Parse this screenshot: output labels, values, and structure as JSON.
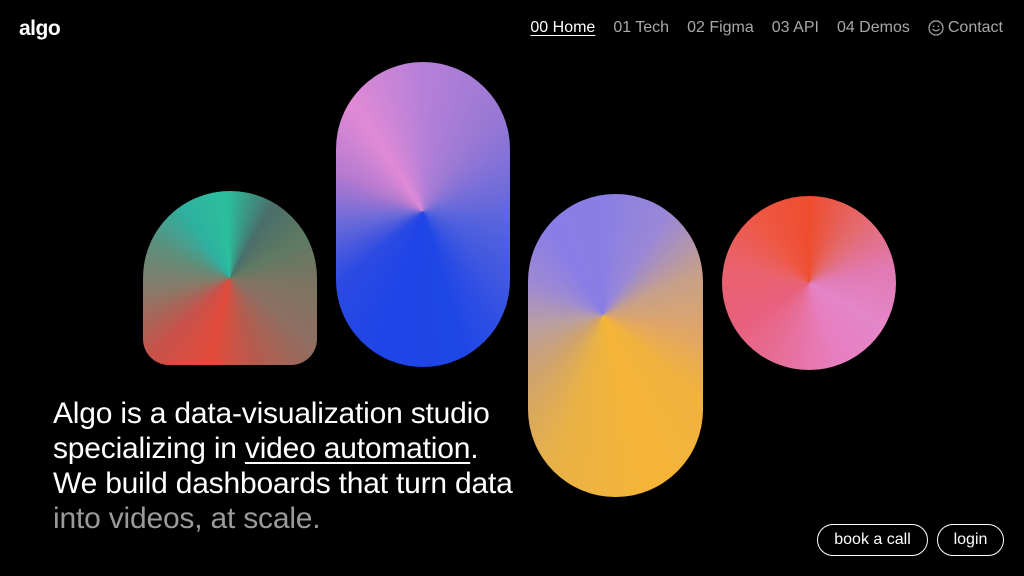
{
  "brand": {
    "logo_text": "algo"
  },
  "nav": {
    "items": [
      {
        "label": "00 Home",
        "active": true
      },
      {
        "label": "01 Tech"
      },
      {
        "label": "02 Figma"
      },
      {
        "label": "03 API"
      },
      {
        "label": "04 Demos"
      }
    ],
    "contact": {
      "label": "Contact",
      "icon": "smile-icon"
    }
  },
  "hero": {
    "line1": "Algo is a data-visualization studio",
    "line2_prefix": "specializing in ",
    "line2_link": "video automation",
    "line2_suffix": ".",
    "line3": "We build dashboards that turn data",
    "line4": "into videos, at scale."
  },
  "buttons": {
    "book_call": "book a call",
    "login": "login"
  },
  "colors": {
    "background": "#000000",
    "text": "#ffffff",
    "muted": "#9a9a9a"
  }
}
